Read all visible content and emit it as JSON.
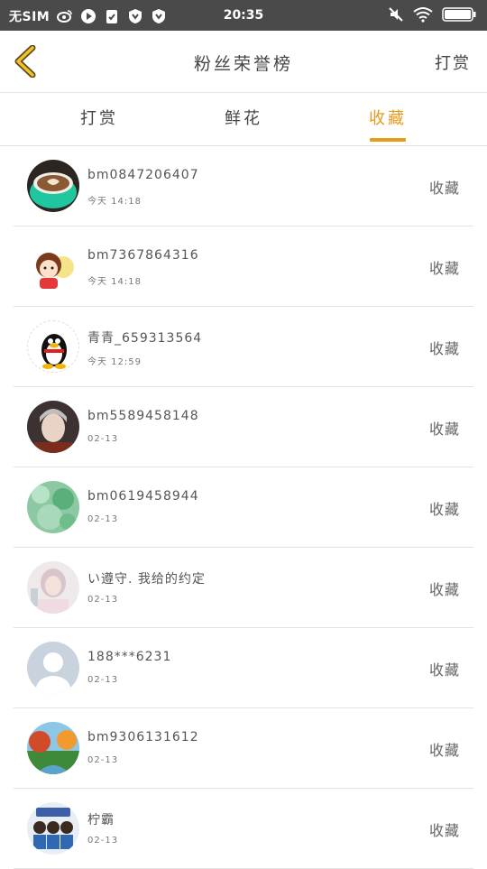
{
  "status_bar": {
    "carrier": "无SIM",
    "time": "20:35"
  },
  "header": {
    "title": "粉丝荣誉榜",
    "right_action": "打赏"
  },
  "tabs": [
    {
      "label": "打赏",
      "active": false
    },
    {
      "label": "鲜花",
      "active": false
    },
    {
      "label": "收藏",
      "active": true
    }
  ],
  "fans": [
    {
      "name": "bm0847206407",
      "time": "今天 14:18",
      "action": "收藏"
    },
    {
      "name": "bm7367864316",
      "time": "今天 14:18",
      "action": "收藏"
    },
    {
      "name": "青青_659313564",
      "time": "今天 12:59",
      "action": "收藏"
    },
    {
      "name": "bm5589458148",
      "time": "02-13",
      "action": "收藏"
    },
    {
      "name": "bm0619458944",
      "time": "02-13",
      "action": "收藏"
    },
    {
      "name": "い遵守. 我给的约定",
      "time": "02-13",
      "action": "收藏"
    },
    {
      "name": "188***6231",
      "time": "02-13",
      "action": "收藏"
    },
    {
      "name": "bm9306131612",
      "time": "02-13",
      "action": "收藏"
    },
    {
      "name": "柠霸",
      "time": "02-13",
      "action": "收藏"
    }
  ],
  "colors": {
    "accent": "#e89a1a",
    "status_bar": "#4a4a4a",
    "divider": "#e3e3e3"
  }
}
